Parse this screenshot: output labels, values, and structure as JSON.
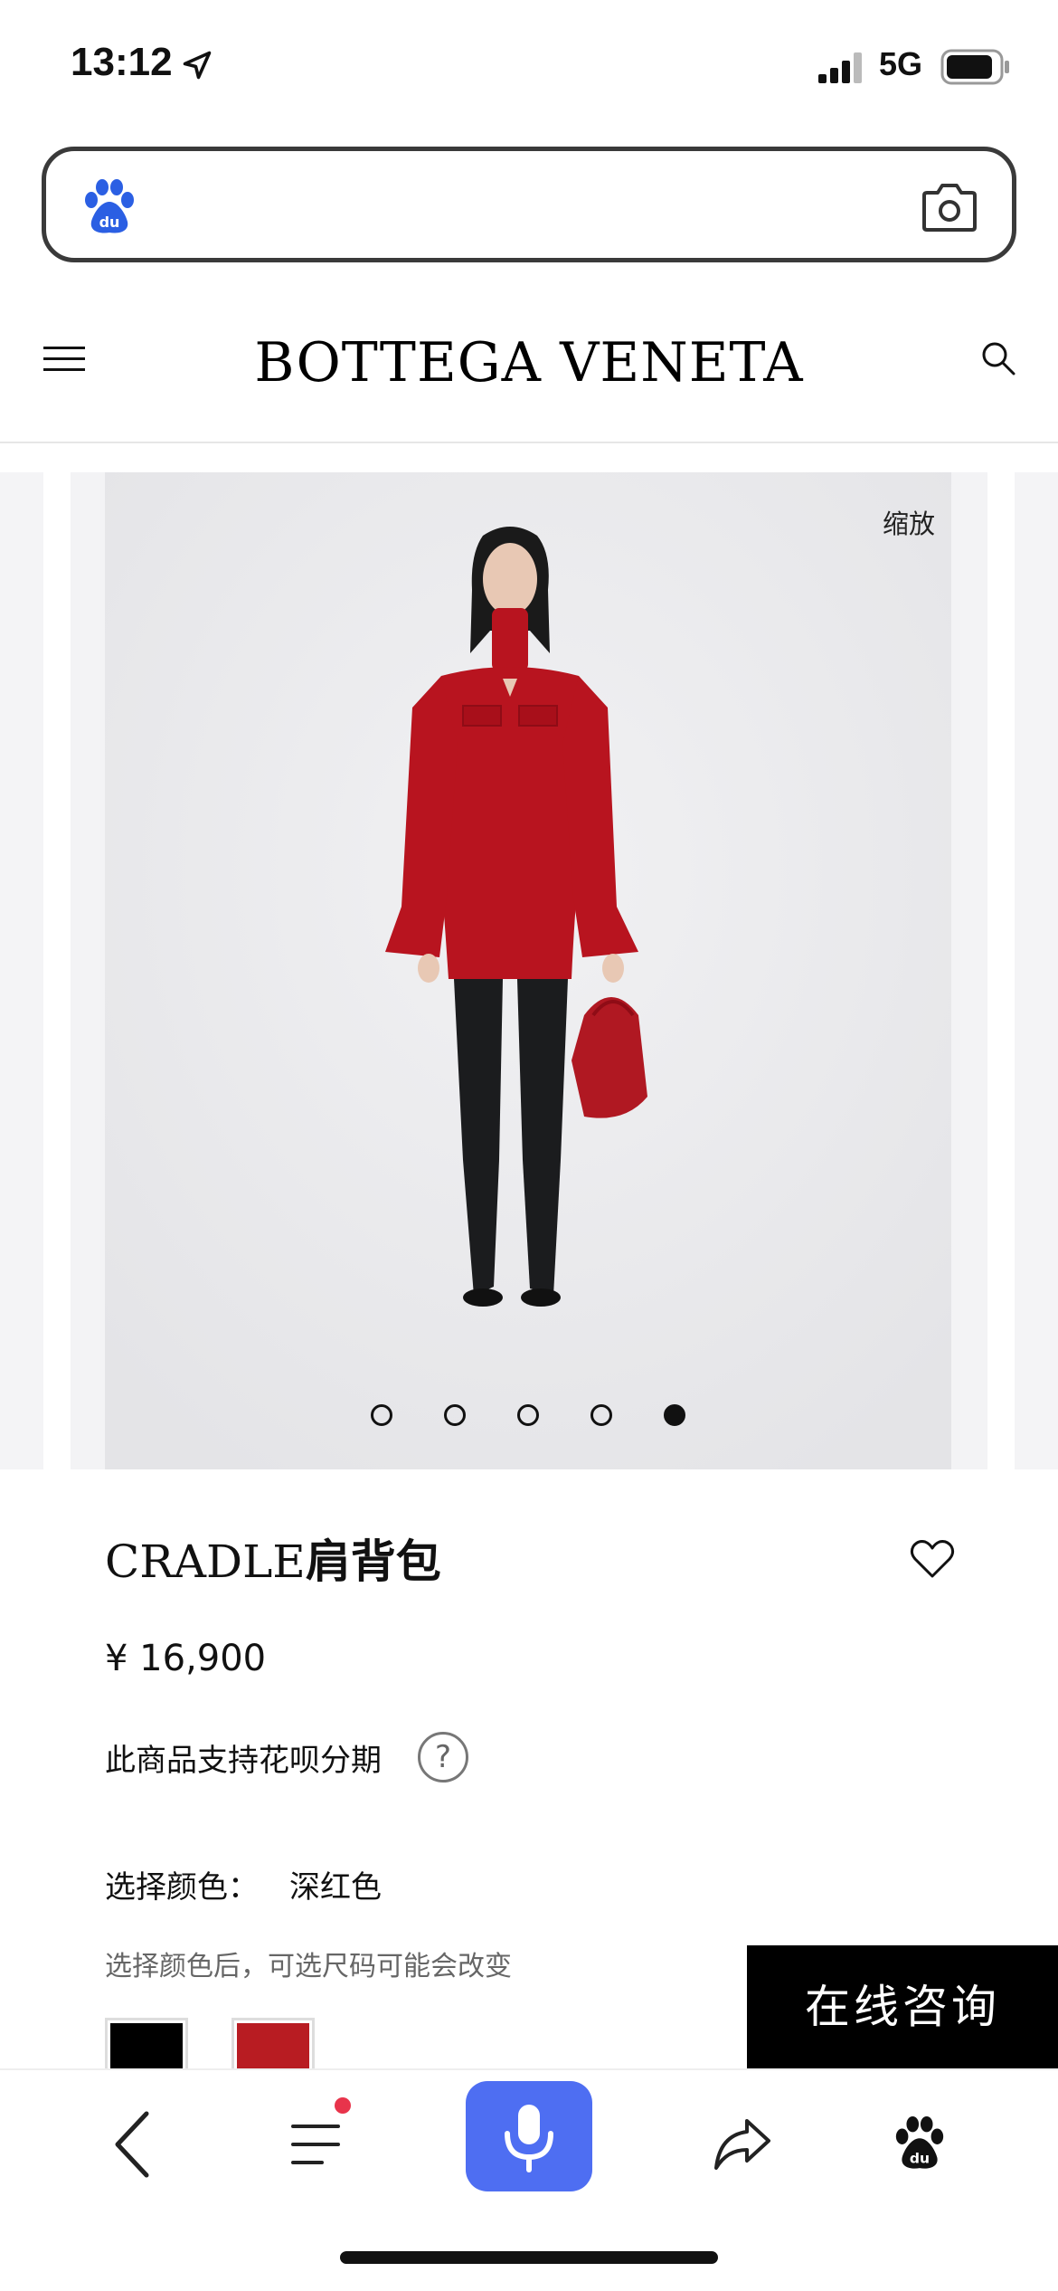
{
  "status_bar": {
    "time": "13:12",
    "network": "5G"
  },
  "search_bar": {
    "placeholder": ""
  },
  "header": {
    "brand": "BOTTEGA VENETA"
  },
  "carousel": {
    "zoom_label": "缩放",
    "slide_count": 5,
    "active_index": 4
  },
  "product": {
    "title_prefix": "CRADLE",
    "title_suffix": "肩背包",
    "price": "¥ 16,900",
    "installment": "此商品支持花呗分期",
    "help_symbol": "?",
    "color_label": "选择颜色：",
    "color_value": "深红色",
    "color_note": "选择颜色后，可选尺码可能会改变",
    "swatches": [
      {
        "name": "black",
        "color": "#000000"
      },
      {
        "name": "red",
        "color": "#b81c22"
      }
    ]
  },
  "consult_button": {
    "label": "在线咨询"
  },
  "colors": {
    "voice_button": "#4e6ef2",
    "badge": "#e8344b",
    "baidu_blue": "#2b5fe3"
  }
}
